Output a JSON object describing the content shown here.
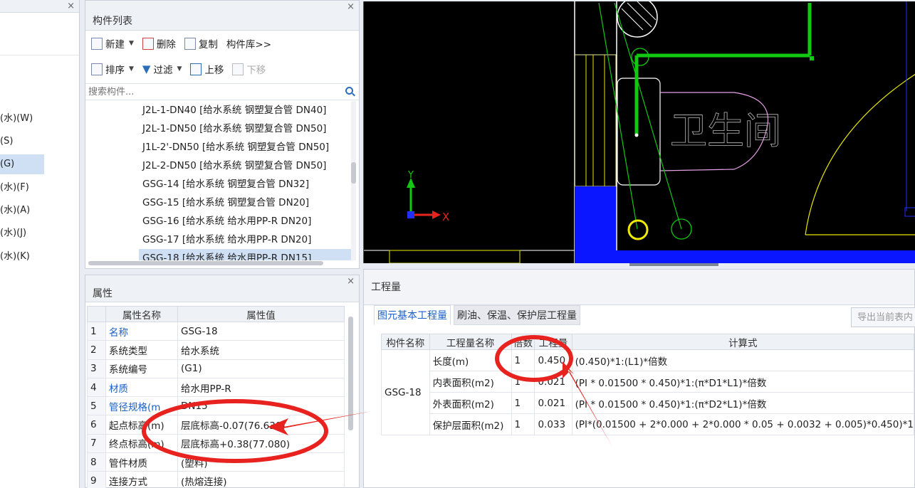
{
  "left_tree": {
    "items": [
      {
        "label": "(水)(W)",
        "selected": false
      },
      {
        "label": "(S)",
        "selected": false
      },
      {
        "label": "(G)",
        "selected": true
      },
      {
        "label": "(水)(F)",
        "selected": false
      },
      {
        "label": "(水)(A)",
        "selected": false
      },
      {
        "label": "(水)(J)",
        "selected": false
      },
      {
        "label": "(水)(K)",
        "selected": false
      }
    ]
  },
  "component_list": {
    "title": "构件列表",
    "toolbar": {
      "new": "新建",
      "delete": "删除",
      "copy": "复制",
      "library": "构件库>>",
      "sort": "排序",
      "filter": "过滤",
      "move_up": "上移",
      "move_down": "下移"
    },
    "search_placeholder": "搜索构件...",
    "items": [
      "J2L-1-DN40 [给水系统 钢塑复合管 DN40]",
      "J2L-1-DN50 [给水系统 钢塑复合管 DN50]",
      "J1L-2'-DN50 [给水系统 钢塑复合管 DN50]",
      "J2L-2-DN50 [给水系统 钢塑复合管 DN50]",
      "GSG-14 [给水系统 钢塑复合管 DN32]",
      "GSG-15 [给水系统 钢塑复合管 DN20]",
      "GSG-16 [给水系统 给水用PP-R DN20]",
      "GSG-17 [给水系统 给水用PP-R DN20]",
      "GSG-18 [给水系统 给水用PP-R DN15]"
    ]
  },
  "properties": {
    "title": "属性",
    "col_name": "属性名称",
    "col_value": "属性值",
    "rows": [
      {
        "num": "1",
        "name": "名称",
        "value": "GSG-18"
      },
      {
        "num": "2",
        "name": "系统类型",
        "value": "给水系统"
      },
      {
        "num": "3",
        "name": "系统编号",
        "value": "(G1)"
      },
      {
        "num": "4",
        "name": "材质",
        "value": "给水用PP-R"
      },
      {
        "num": "5",
        "name": "管径规格(m",
        "value": "DN15"
      },
      {
        "num": "6",
        "name": "起点标高(m)",
        "value": "层底标高-0.07(76.630)"
      },
      {
        "num": "7",
        "name": "终点标高(m)",
        "value": "层底标高+0.38(77.080)"
      },
      {
        "num": "8",
        "name": "管件材质",
        "value": "(塑料)"
      },
      {
        "num": "9",
        "name": "连接方式",
        "value": "(热熔连接)"
      }
    ]
  },
  "cad": {
    "room_label": "卫生间",
    "axis_x": "X",
    "axis_y": "Y"
  },
  "quantities": {
    "title": "工程量",
    "tabs": [
      "图元基本工程量",
      "刷油、保温、保护层工程量"
    ],
    "export_label": "导出当前表内",
    "headers": [
      "构件名称",
      "工程量名称",
      "倍数",
      "工程量",
      "计算式"
    ],
    "component": "GSG-18",
    "rows": [
      {
        "name": "长度(m)",
        "mult": "1",
        "value": "0.450",
        "formula": "(0.450)*1:(L1)*倍数"
      },
      {
        "name": "内表面积(m2)",
        "mult": "1",
        "value": "0.021",
        "formula": "(PI * 0.01500 * 0.450)*1:(π*D1*L1)*倍数"
      },
      {
        "name": "外表面积(m2)",
        "mult": "1",
        "value": "0.021",
        "formula": "(PI * 0.01500 * 0.450)*1:(π*D2*L1)*倍数"
      },
      {
        "name": "保护层面积(m2)",
        "mult": "1",
        "value": "0.033",
        "formula": "(PI*(0.01500 + 2*0.000 + 2*0.000 * 0.05 + 0.0032 + 0.005)*0.450)*1"
      }
    ]
  },
  "colors": {
    "annotation": "#e8231f",
    "link_blue": "#1b5fc7",
    "selection": "#cfe0f5"
  }
}
